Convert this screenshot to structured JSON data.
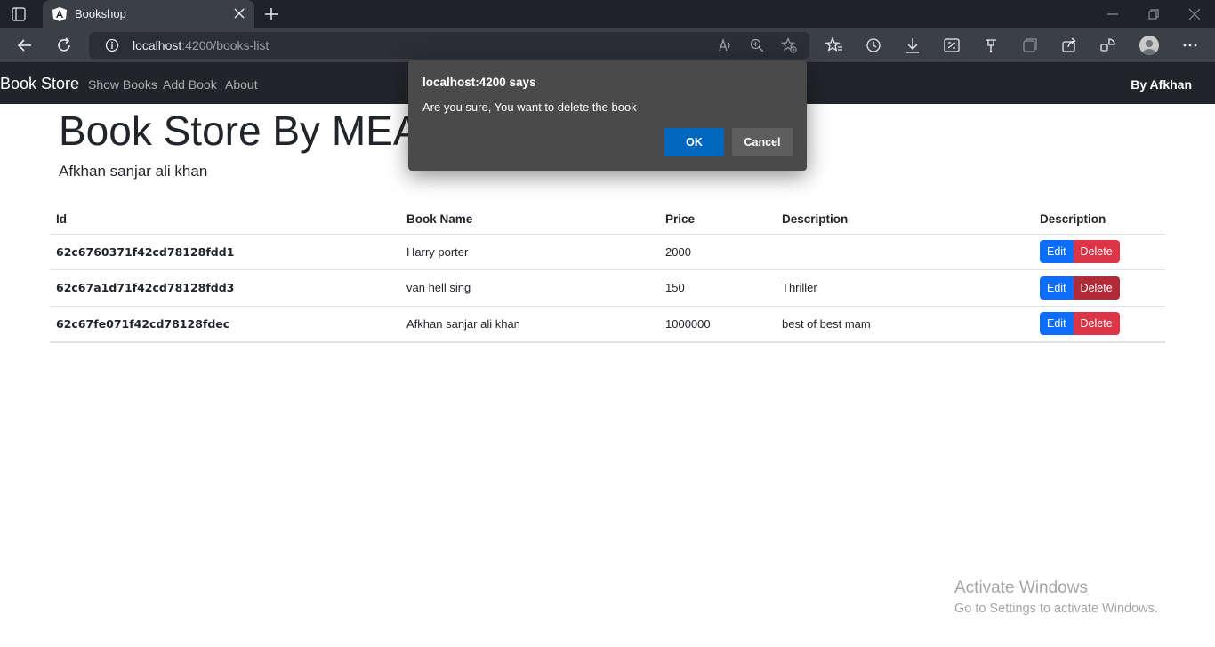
{
  "browser": {
    "tab_title": "Bookshop",
    "url_host": "localhost",
    "url_path": ":4200/books-list"
  },
  "navbar": {
    "brand": "Book Store",
    "links": [
      "Show Books",
      "Add Book",
      "About"
    ],
    "author": "By Afkhan"
  },
  "page": {
    "title": "Book Store By MEAN",
    "subtitle": "Afkhan sanjar ali khan"
  },
  "table": {
    "headers": [
      "Id",
      "Book Name",
      "Price",
      "Description",
      "Description"
    ],
    "rows": [
      {
        "id": "62c6760371f42cd78128fdd1",
        "name": "Harry porter",
        "price": "2000",
        "description": ""
      },
      {
        "id": "62c67a1d71f42cd78128fdd3",
        "name": "van hell sing",
        "price": "150",
        "description": "Thriller"
      },
      {
        "id": "62c67fe071f42cd78128fdec",
        "name": "Afkhan sanjar ali khan",
        "price": "1000000",
        "description": "best of best mam"
      }
    ],
    "edit_label": "Edit",
    "delete_label": "Delete"
  },
  "dialog": {
    "title": "localhost:4200 says",
    "message": "Are you sure, You want to delete the book",
    "ok_label": "OK",
    "cancel_label": "Cancel"
  },
  "watermark": {
    "title": "Activate Windows",
    "subtitle": "Go to Settings to activate Windows."
  },
  "colors": {
    "navbar_bg": "#212529",
    "edit_button": "#0d6efd",
    "delete_button": "#dc3545",
    "dialog_bg": "#4a4a4a",
    "dialog_ok": "#0067c0"
  },
  "icons": [
    "tab-actions-icon",
    "angular-favicon-icon",
    "close-tab-icon",
    "new-tab-icon",
    "minimize-icon",
    "restore-icon",
    "window-close-icon",
    "back-icon",
    "refresh-icon",
    "site-info-icon",
    "read-aloud-icon",
    "zoom-icon",
    "add-favorite-icon",
    "favorites-icon",
    "history-icon",
    "downloads-icon",
    "web-capture-icon",
    "extensions-icon",
    "collections-icon",
    "share-icon",
    "performance-icon",
    "profile-icon",
    "more-icon"
  ]
}
